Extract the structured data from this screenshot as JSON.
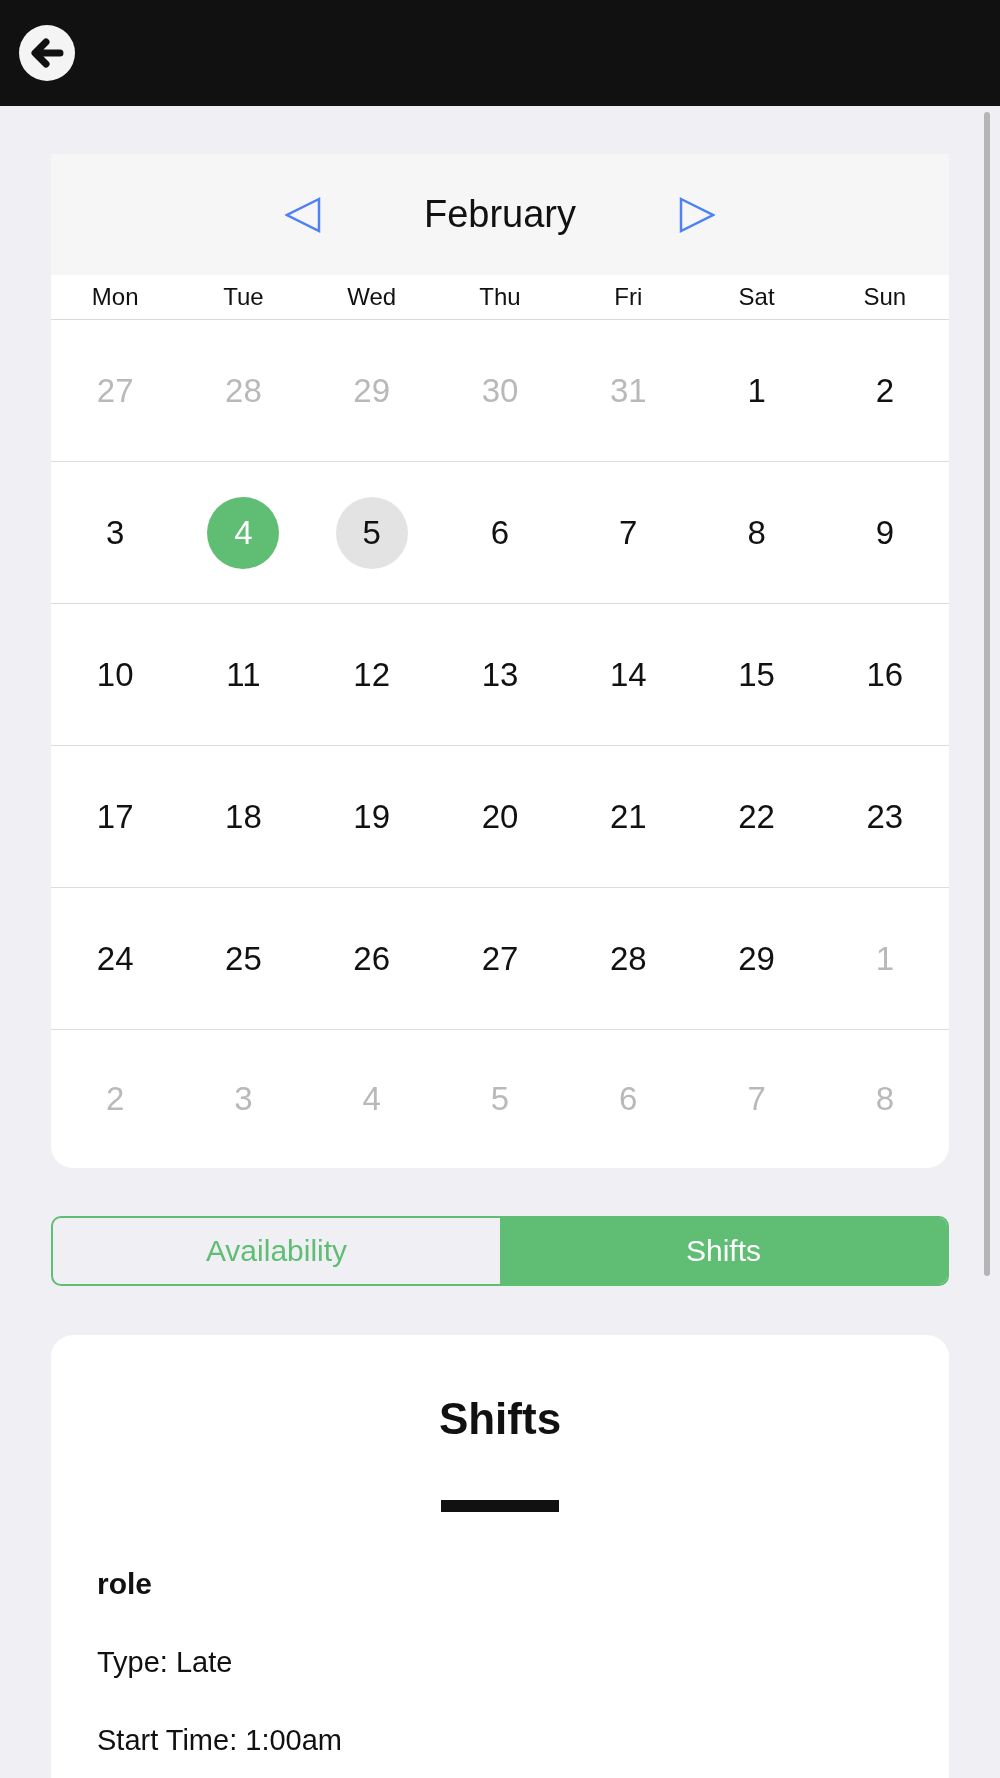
{
  "calendar": {
    "month": "February",
    "weekdays": [
      "Mon",
      "Tue",
      "Wed",
      "Thu",
      "Fri",
      "Sat",
      "Sun"
    ],
    "weeks": [
      [
        {
          "day": "27",
          "outside_month": true,
          "selected": false,
          "today": false
        },
        {
          "day": "28",
          "outside_month": true,
          "selected": false,
          "today": false
        },
        {
          "day": "29",
          "outside_month": true,
          "selected": false,
          "today": false
        },
        {
          "day": "30",
          "outside_month": true,
          "selected": false,
          "today": false
        },
        {
          "day": "31",
          "outside_month": true,
          "selected": false,
          "today": false
        },
        {
          "day": "1",
          "outside_month": false,
          "selected": false,
          "today": false
        },
        {
          "day": "2",
          "outside_month": false,
          "selected": false,
          "today": false
        }
      ],
      [
        {
          "day": "3",
          "outside_month": false,
          "selected": false,
          "today": false
        },
        {
          "day": "4",
          "outside_month": false,
          "selected": true,
          "today": false
        },
        {
          "day": "5",
          "outside_month": false,
          "selected": false,
          "today": true
        },
        {
          "day": "6",
          "outside_month": false,
          "selected": false,
          "today": false
        },
        {
          "day": "7",
          "outside_month": false,
          "selected": false,
          "today": false
        },
        {
          "day": "8",
          "outside_month": false,
          "selected": false,
          "today": false
        },
        {
          "day": "9",
          "outside_month": false,
          "selected": false,
          "today": false
        }
      ],
      [
        {
          "day": "10",
          "outside_month": false,
          "selected": false,
          "today": false
        },
        {
          "day": "11",
          "outside_month": false,
          "selected": false,
          "today": false
        },
        {
          "day": "12",
          "outside_month": false,
          "selected": false,
          "today": false
        },
        {
          "day": "13",
          "outside_month": false,
          "selected": false,
          "today": false
        },
        {
          "day": "14",
          "outside_month": false,
          "selected": false,
          "today": false
        },
        {
          "day": "15",
          "outside_month": false,
          "selected": false,
          "today": false
        },
        {
          "day": "16",
          "outside_month": false,
          "selected": false,
          "today": false
        }
      ],
      [
        {
          "day": "17",
          "outside_month": false,
          "selected": false,
          "today": false
        },
        {
          "day": "18",
          "outside_month": false,
          "selected": false,
          "today": false
        },
        {
          "day": "19",
          "outside_month": false,
          "selected": false,
          "today": false
        },
        {
          "day": "20",
          "outside_month": false,
          "selected": false,
          "today": false
        },
        {
          "day": "21",
          "outside_month": false,
          "selected": false,
          "today": false
        },
        {
          "day": "22",
          "outside_month": false,
          "selected": false,
          "today": false
        },
        {
          "day": "23",
          "outside_month": false,
          "selected": false,
          "today": false
        }
      ],
      [
        {
          "day": "24",
          "outside_month": false,
          "selected": false,
          "today": false
        },
        {
          "day": "25",
          "outside_month": false,
          "selected": false,
          "today": false
        },
        {
          "day": "26",
          "outside_month": false,
          "selected": false,
          "today": false
        },
        {
          "day": "27",
          "outside_month": false,
          "selected": false,
          "today": false
        },
        {
          "day": "28",
          "outside_month": false,
          "selected": false,
          "today": false
        },
        {
          "day": "29",
          "outside_month": false,
          "selected": false,
          "today": false
        },
        {
          "day": "1",
          "outside_month": true,
          "selected": false,
          "today": false
        }
      ],
      [
        {
          "day": "2",
          "outside_month": true,
          "selected": false,
          "today": false
        },
        {
          "day": "3",
          "outside_month": true,
          "selected": false,
          "today": false
        },
        {
          "day": "4",
          "outside_month": true,
          "selected": false,
          "today": false
        },
        {
          "day": "5",
          "outside_month": true,
          "selected": false,
          "today": false
        },
        {
          "day": "6",
          "outside_month": true,
          "selected": false,
          "today": false
        },
        {
          "day": "7",
          "outside_month": true,
          "selected": false,
          "today": false
        },
        {
          "day": "8",
          "outside_month": true,
          "selected": false,
          "today": false
        }
      ]
    ]
  },
  "tabs": [
    {
      "label": "Availability",
      "selected": false
    },
    {
      "label": "Shifts",
      "selected": true
    }
  ],
  "shifts_panel": {
    "title": "Shifts",
    "shifts": [
      {
        "role": "role",
        "details": [
          "Type: Late",
          "Start Time: 1:00am"
        ]
      }
    ]
  }
}
